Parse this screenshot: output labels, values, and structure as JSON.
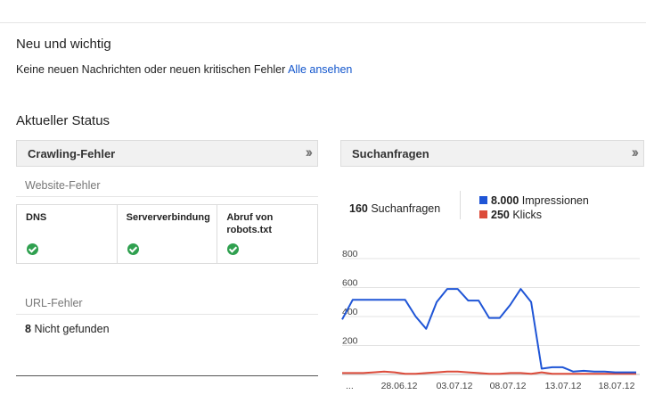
{
  "new_section": {
    "title": "Neu und wichtig",
    "message": "Keine neuen Nachrichten oder neuen kritischen Fehler",
    "link": "Alle ansehen"
  },
  "status_section": {
    "title": "Aktueller Status"
  },
  "crawl_panel": {
    "title": "Crawling-Fehler",
    "website_errors_label": "Website-Fehler",
    "checks": [
      {
        "label_line1": "DNS",
        "label_line2": "",
        "status": "ok"
      },
      {
        "label_line1": "Serververbindung",
        "label_line2": "",
        "status": "ok"
      },
      {
        "label_line1": "Abruf von",
        "label_line2": "robots.txt",
        "status": "ok"
      }
    ],
    "url_errors_label": "URL-Fehler",
    "url_errors_count": "8",
    "url_errors_text": "Nicht gefunden"
  },
  "search_panel": {
    "title": "Suchanfragen",
    "queries_count": "160",
    "queries_label": "Suchanfragen",
    "impressions_value": "8.000",
    "impressions_label": "Impressionen",
    "clicks_value": "250",
    "clicks_label": "Klicks"
  },
  "colors": {
    "impressions": "#1f55d6",
    "clicks": "#dc4b3a",
    "link": "#1155cc",
    "ok": "#2fa04f"
  },
  "icons": {
    "panel_expand": "double-chevron-right-icon",
    "status_ok": "check-circle-icon"
  },
  "chart_data": {
    "type": "line",
    "yticks": [
      800,
      600,
      400,
      200
    ],
    "ylim": [
      0,
      800
    ],
    "xtick_labels": [
      "...",
      "28.06.12",
      "03.07.12",
      "08.07.12",
      "13.07.12",
      "18.07.12"
    ],
    "series": [
      {
        "name": "Impressionen",
        "color": "#1f55d6",
        "values": [
          380,
          515,
          515,
          515,
          515,
          515,
          515,
          400,
          315,
          500,
          590,
          590,
          510,
          510,
          390,
          390,
          480,
          590,
          500,
          40,
          50,
          50,
          20,
          25,
          20,
          20,
          15,
          15,
          15
        ]
      },
      {
        "name": "Klicks",
        "color": "#dc4b3a",
        "values": [
          10,
          10,
          10,
          15,
          20,
          15,
          5,
          5,
          10,
          15,
          20,
          20,
          15,
          10,
          5,
          5,
          10,
          10,
          5,
          15,
          5,
          5,
          5,
          5,
          5,
          5,
          5,
          5,
          5
        ]
      }
    ]
  }
}
